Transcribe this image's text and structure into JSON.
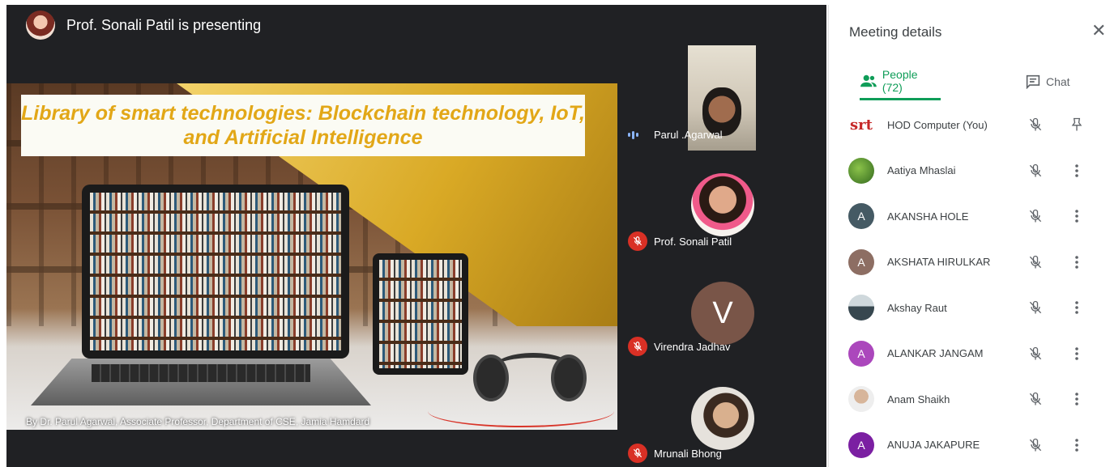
{
  "presenter": {
    "banner_text": "Prof. Sonali Patil is presenting",
    "avatar_icon": "presenter-avatar"
  },
  "slide": {
    "title": "Library of smart technologies: Blockchain technology, IoT, and Artificial Intelligence",
    "credit": "By Dr. Parul Agarwal, Associate Professor, Department of CSE, Jamia Hamdard",
    "title_color": "#e2a717"
  },
  "tiles": [
    {
      "name": "Parul .Agarwal",
      "status_icon": "speaking-icon"
    },
    {
      "name": "Prof. Sonali Patil",
      "status_icon": "mic-off-icon"
    },
    {
      "name": "Virendra Jadhav",
      "status_icon": "mic-off-icon",
      "avatar_letter": "V"
    },
    {
      "name": "Mrunali Bhong",
      "status_icon": "mic-off-icon"
    }
  ],
  "panel": {
    "title": "Meeting details",
    "close_icon": "close-icon",
    "tabs": [
      {
        "label": "People (72)",
        "icon": "people-icon",
        "active": true
      },
      {
        "label": "Chat",
        "icon": "chat-icon",
        "active": false
      }
    ],
    "accent_color": "#0f9d58",
    "participants": [
      {
        "name": "HOD Computer (You)",
        "avatar": "srt",
        "action_icon": "pin-icon"
      },
      {
        "name": "Aatiya Mhaslai",
        "avatar": "photo",
        "action_icon": "more-vert-icon"
      },
      {
        "name": "AKANSHA HOLE",
        "avatar": "A",
        "avatar_color": "#455a64",
        "action_icon": "more-vert-icon"
      },
      {
        "name": "AKSHATA HIRULKAR",
        "avatar": "A",
        "avatar_color": "#8d6e63",
        "action_icon": "more-vert-icon"
      },
      {
        "name": "Akshay Raut",
        "avatar": "photo",
        "action_icon": "more-vert-icon"
      },
      {
        "name": "ALANKAR JANGAM",
        "avatar": "A",
        "avatar_color": "#ab47bc",
        "action_icon": "more-vert-icon"
      },
      {
        "name": "Anam Shaikh",
        "avatar": "photo",
        "action_icon": "more-vert-icon"
      },
      {
        "name": "ANUJA JAKAPURE",
        "avatar": "A",
        "avatar_color": "#7b1fa2",
        "action_icon": "more-vert-icon"
      }
    ]
  }
}
